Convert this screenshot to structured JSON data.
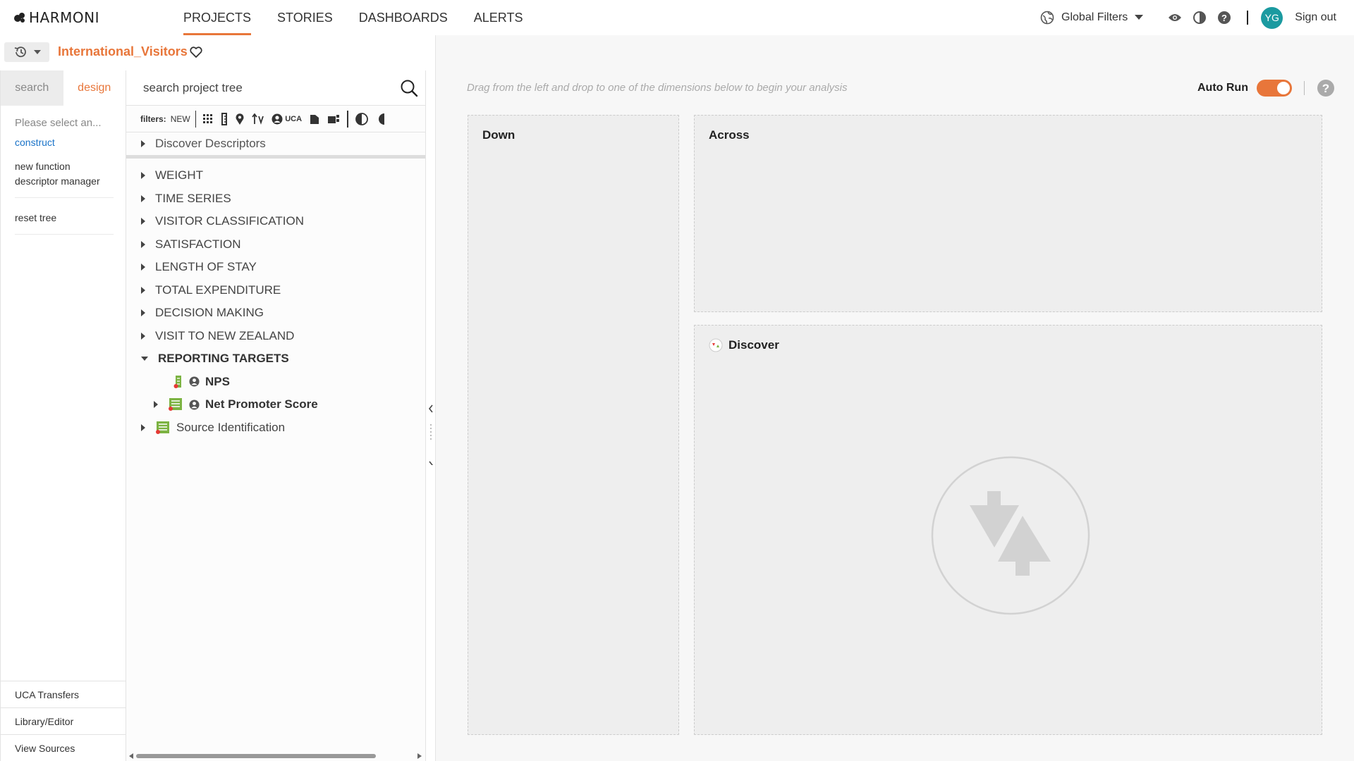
{
  "app": {
    "brand": "HARMONI",
    "accent": "#e8763a",
    "link_color": "#1a73c8",
    "avatar_color": "#1b9aa0"
  },
  "nav": {
    "items": [
      "PROJECTS",
      "STORIES",
      "DASHBOARDS",
      "ALERTS"
    ],
    "active": "PROJECTS"
  },
  "header": {
    "global_filters": "Global Filters",
    "user_initials": "YG",
    "sign_out": "Sign out"
  },
  "project": {
    "name": "International_Visitors"
  },
  "sidebar": {
    "tabs": [
      "search",
      "design"
    ],
    "active_tab": "design",
    "placeholder": "Please select an...",
    "items": {
      "construct": "construct",
      "new_function": "new function",
      "descriptor_manager": "descriptor manager",
      "reset_tree": "reset tree"
    },
    "bottom": [
      "UCA Transfers",
      "Library/Editor",
      "View Sources"
    ]
  },
  "tree": {
    "search_placeholder": "search project tree",
    "filters_label": "filters:",
    "filter_new": "NEW",
    "filter_uca": "UCA",
    "discover_row": "Discover Descriptors",
    "nodes": [
      "WEIGHT",
      "TIME SERIES",
      "VISITOR CLASSIFICATION",
      "SATISFACTION",
      "LENGTH OF STAY",
      "TOTAL EXPENDITURE",
      "DECISION MAKING",
      "VISIT TO NEW ZEALAND"
    ],
    "expanded": "REPORTING TARGETS",
    "children": [
      "NPS",
      "Net Promoter Score"
    ],
    "last": "Source Identification"
  },
  "canvas": {
    "hint": "Drag from the left and drop to one of the dimensions below to begin your analysis",
    "auto_run": "Auto Run",
    "auto_run_on": true,
    "down": "Down",
    "across": "Across",
    "discover": "Discover"
  }
}
